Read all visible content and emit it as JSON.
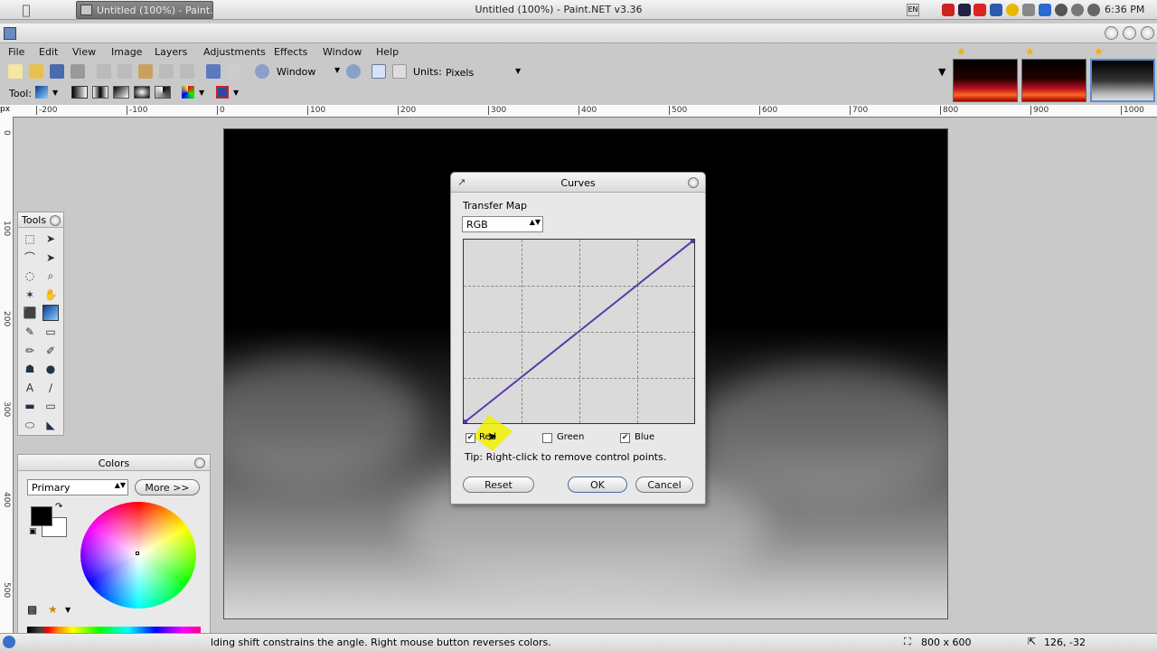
{
  "system_bar": {
    "task_title": "Untitled (100%) - Paint...",
    "lang": "EN",
    "clock": "6:36 PM"
  },
  "window": {
    "title": "Untitled (100%) - Paint.NET v3.36"
  },
  "menu": [
    "File",
    "Edit",
    "View",
    "Image",
    "Layers",
    "Adjustments",
    "Effects",
    "Window",
    "Help"
  ],
  "toolbar": {
    "zoom_value": "Window",
    "units_label": "Units:",
    "units_value": "Pixels",
    "tool_label": "Tool:"
  },
  "ruler": {
    "unit": "px",
    "h_labels": [
      "-200",
      "-100",
      "0",
      "100",
      "200",
      "300",
      "400",
      "500",
      "600",
      "700",
      "800",
      "900",
      "1000"
    ],
    "v_labels": [
      "0",
      "100",
      "200",
      "300",
      "400",
      "500"
    ]
  },
  "tools_panel": {
    "title": "Tools",
    "icons": [
      "rect-select-icon",
      "move-selection-icon",
      "lasso-icon",
      "move-selected-icon",
      "ellipse-select-icon",
      "zoom-icon",
      "magic-wand-icon",
      "pan-icon",
      "paint-bucket-icon",
      "gradient-icon",
      "paintbrush-icon",
      "eraser-icon",
      "pencil-icon",
      "color-picker-icon",
      "clone-stamp-icon",
      "recolor-icon",
      "text-icon",
      "line-curve-icon",
      "rectangle-icon",
      "rounded-rect-icon",
      "ellipse-icon",
      "freeform-shape-icon"
    ]
  },
  "colors_panel": {
    "title": "Colors",
    "mode": "Primary",
    "more_button": "More >>",
    "primary_color": "#000000",
    "secondary_color": "#ffffff"
  },
  "curves_dialog": {
    "title": "Curves",
    "section": "Transfer Map",
    "mode": "RGB",
    "channels": [
      {
        "label": "Red",
        "checked": true
      },
      {
        "label": "Green",
        "checked": false
      },
      {
        "label": "Blue",
        "checked": true
      }
    ],
    "tip": "Tip: Right-click to remove control points.",
    "reset_button": "Reset",
    "ok_button": "OK",
    "cancel_button": "Cancel",
    "curve_color": "#5a3aa8"
  },
  "status": {
    "hint": "lding shift constrains the angle. Right mouse button reverses colors.",
    "image_size": "800 x 600",
    "cursor_pos": "126, -32"
  }
}
